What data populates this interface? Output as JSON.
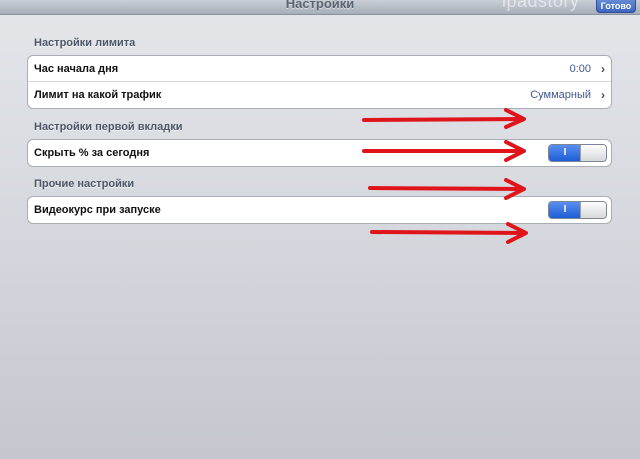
{
  "navbar": {
    "title": "Настройки",
    "watermark": "ipadstory",
    "done_label": "Готово"
  },
  "sections": [
    {
      "header": "Настройки лимита",
      "rows": [
        {
          "label": "Час начала дня",
          "value": "0:00"
        },
        {
          "label": "Лимит на какой трафик",
          "value": "Суммарный"
        }
      ]
    },
    {
      "header": "Настройки первой вкладки",
      "rows": [
        {
          "label": "Скрыть % за сегодня",
          "toggle_state": "on",
          "toggle_text": "I"
        }
      ]
    },
    {
      "header": "Прочие настройки",
      "rows": [
        {
          "label": "Видеокурс при запуске",
          "toggle_state": "on",
          "toggle_text": "I"
        }
      ]
    }
  ],
  "colors": {
    "annotation_arrow": "#e0141b",
    "switch_on": "#1c5ed6",
    "done_button": "#3f66bf"
  },
  "icons": [
    "chevron-right-icon",
    "annotation-arrow-icon"
  ]
}
